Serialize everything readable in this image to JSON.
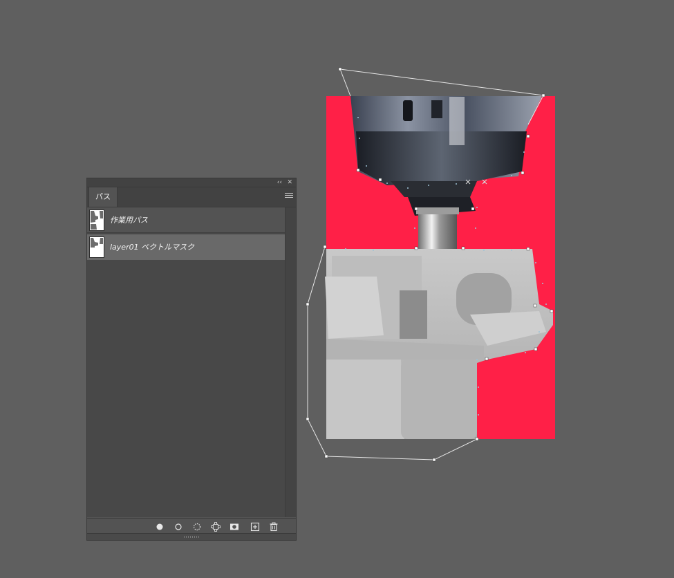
{
  "panel": {
    "tab_label": "パス",
    "collapse_glyph": "‹‹",
    "close_glyph": "✕"
  },
  "paths": [
    {
      "label": "作業用パス",
      "selected": false
    },
    {
      "label": "layer01 ベクトルマスク",
      "selected": true
    }
  ],
  "toolbar": [
    {
      "name": "fill-path-button",
      "icon": "filled-circle-icon"
    },
    {
      "name": "stroke-path-button",
      "icon": "hollow-circle-icon"
    },
    {
      "name": "load-as-selection-button",
      "icon": "dotted-circle-icon"
    },
    {
      "name": "make-work-path-button",
      "icon": "path-from-selection-icon"
    },
    {
      "name": "add-mask-button",
      "icon": "mask-icon"
    },
    {
      "name": "new-path-button",
      "icon": "plus-square-icon"
    },
    {
      "name": "delete-path-button",
      "icon": "trash-icon"
    }
  ],
  "colors": {
    "canvas_bg": "#5f5f5f",
    "mask_red": "#ff2047",
    "panel_bg": "#535353",
    "selected_row": "#696969"
  },
  "icons": {
    "panel_menu": "hamburger-icon"
  }
}
